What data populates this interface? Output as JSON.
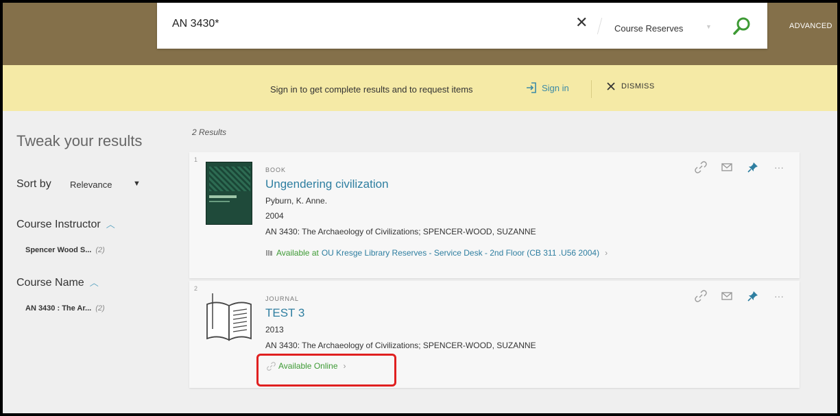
{
  "search": {
    "query": "AN 3430*",
    "scope": "Course Reserves",
    "advanced_label": "ADVANCED"
  },
  "banner": {
    "message": "Sign in to get complete results and to request items",
    "signin_label": "Sign in",
    "dismiss_label": "DISMISS"
  },
  "sidebar": {
    "heading": "Tweak your results",
    "sort_label": "Sort by",
    "sort_value": "Relevance",
    "facets": [
      {
        "title": "Course Instructor",
        "value": "Spencer Wood S...",
        "count": "(2)"
      },
      {
        "title": "Course Name",
        "value": "AN 3430 : The Ar...",
        "count": "(2)"
      }
    ]
  },
  "results": {
    "count_label": "2 Results",
    "items": [
      {
        "number": "1",
        "type": "BOOK",
        "title": "Ungendering civilization",
        "author": "Pyburn, K. Anne.",
        "year": "2004",
        "course": "AN 3430: The Archaeology of Civilizations; SPENCER-WOOD, SUZANNE",
        "availability_status": "Available at",
        "availability_location": "OU Kresge Library  Reserves - Service Desk - 2nd Floor (CB 311 .U56 2004)"
      },
      {
        "number": "2",
        "type": "JOURNAL",
        "title": "TEST 3",
        "year": "2013",
        "course": "AN 3430: The Archaeology of Civilizations; SPENCER-WOOD, SUZANNE",
        "availability_status": "Available Online"
      }
    ]
  },
  "colors": {
    "header": "#84704a",
    "banner": "#f5eaa6",
    "link": "#2e7ea0",
    "available": "#3d9a34",
    "highlight": "#e02020"
  }
}
